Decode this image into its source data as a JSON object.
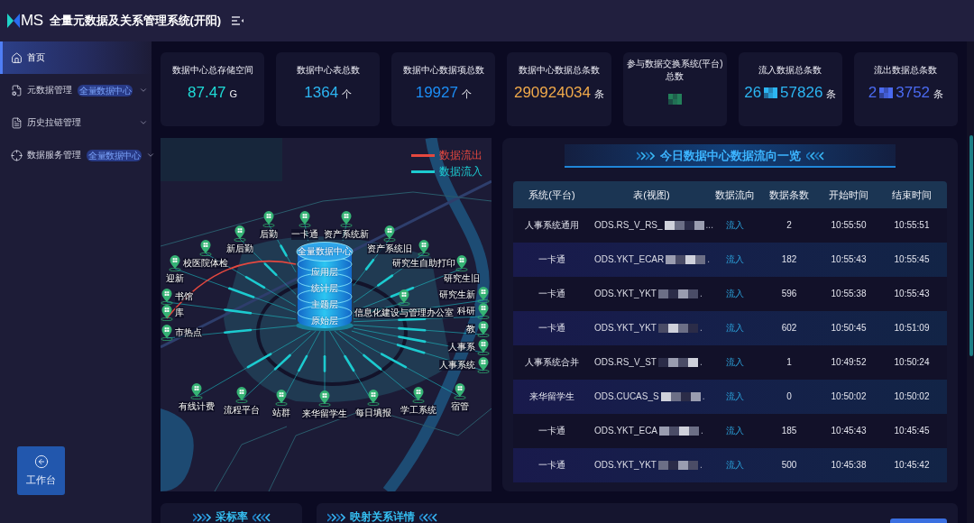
{
  "header": {
    "logo_text": "MS",
    "title": "全量元数据及关系管理系统(开阳)"
  },
  "sidebar": {
    "items": [
      {
        "label": "首页",
        "kind": "home",
        "selected": true
      },
      {
        "label": "元数据管理",
        "kind": "metadata",
        "badge": "全量数据中心",
        "expanded": false,
        "selected": false
      },
      {
        "label": "历史拉链管理",
        "kind": "history",
        "expanded": false,
        "selected": false
      },
      {
        "label": "数据服务管理",
        "kind": "service",
        "badge": "全量数据中心",
        "expanded": false,
        "selected": false
      }
    ],
    "workbench_button": "工作台"
  },
  "stats": [
    {
      "title": "数据中心总存储空间",
      "kind": "plain",
      "value": "87.47",
      "unit": "G",
      "color": "#1fdbd6"
    },
    {
      "title": "数据中心表总数",
      "kind": "plain",
      "value": "1364",
      "unit": "个",
      "color": "#2cb5f2"
    },
    {
      "title": "数据中心数据项总数",
      "kind": "plain",
      "value": "19927",
      "unit": "个",
      "color": "#1c8df5"
    },
    {
      "title": "数据中心数据总条数",
      "kind": "plain",
      "value": "290924034",
      "unit": "条",
      "color": "#f0a94a"
    },
    {
      "title": "参与数据交换系统(平台)总数",
      "kind": "masked",
      "color": "#23805a"
    },
    {
      "title": "流入数据总条数",
      "kind": "masked",
      "parts": [
        "26",
        "57826"
      ],
      "unit": "条",
      "color": "#2cb5f2"
    },
    {
      "title": "流出数据总条数",
      "kind": "masked",
      "parts": [
        "2",
        "3752"
      ],
      "unit": "条",
      "color": "#4a6af0"
    }
  ],
  "map": {
    "legend": [
      {
        "label": "数据流出",
        "kind": "out",
        "color": "#e5483f"
      },
      {
        "label": "数据流入",
        "kind": "in",
        "color": "#1ccbd0"
      }
    ],
    "center": {
      "title": "全量数据中心",
      "layers": [
        "应用层",
        "统计层",
        "主题层",
        "原始层"
      ]
    },
    "nodes": [
      {
        "label": "后勤",
        "kind": "in"
      },
      {
        "label": "一卡通",
        "kind": "in"
      },
      {
        "label": "资产系统新",
        "kind": "in"
      },
      {
        "label": "新后勤",
        "kind": "in"
      },
      {
        "label": "资产系统旧",
        "kind": "in"
      },
      {
        "label": "校医院体检",
        "kind": "in"
      },
      {
        "label": "研究生自助打印",
        "kind": "in"
      },
      {
        "label": "迎新",
        "kind": "in"
      },
      {
        "label": "研究生旧",
        "kind": "in"
      },
      {
        "label": "书馆",
        "kind": "in"
      },
      {
        "label": "研究生新",
        "kind": "in"
      },
      {
        "label": "库",
        "kind": "out"
      },
      {
        "label": "信息化建设与管理办公室",
        "kind": "in"
      },
      {
        "label": "科研",
        "kind": "in"
      },
      {
        "label": "市热点",
        "kind": "in"
      },
      {
        "label": "教",
        "kind": "in"
      },
      {
        "label": "人事系",
        "kind": "in"
      },
      {
        "label": "人事系统",
        "kind": "in"
      },
      {
        "label": "有线计费",
        "kind": "in"
      },
      {
        "label": "流程平台",
        "kind": "in"
      },
      {
        "label": "站群",
        "kind": "in"
      },
      {
        "label": "来华留学生",
        "kind": "in"
      },
      {
        "label": "每日填报",
        "kind": "in"
      },
      {
        "label": "学工系统",
        "kind": "in"
      },
      {
        "label": "宿管",
        "kind": "in"
      }
    ]
  },
  "table": {
    "title": "今日数据中心数据流向一览",
    "columns": [
      "系统(平台)",
      "表(视图)",
      "数据流向",
      "数据条数",
      "开始时间",
      "结束时间"
    ],
    "rows": [
      {
        "system": "人事系统通用",
        "table": "ODS.RS_V_RS_",
        "tail": "...",
        "direction": "流入",
        "count": "2",
        "start": "10:55:50",
        "end": "10:55:51"
      },
      {
        "system": "一卡通",
        "table": "ODS.YKT_ECAR",
        "tail": ".",
        "direction": "流入",
        "count": "182",
        "start": "10:55:43",
        "end": "10:55:45"
      },
      {
        "system": "一卡通",
        "table": "ODS.YKT_YKT",
        "tail": ".",
        "direction": "流入",
        "count": "596",
        "start": "10:55:38",
        "end": "10:55:43"
      },
      {
        "system": "一卡通",
        "table": "ODS.YKT_YKT",
        "tail": ".",
        "direction": "流入",
        "count": "602",
        "start": "10:50:45",
        "end": "10:51:09"
      },
      {
        "system": "人事系统合并",
        "table": "ODS.RS_V_ST",
        "tail": ".",
        "direction": "流入",
        "count": "1",
        "start": "10:49:52",
        "end": "10:50:24"
      },
      {
        "system": "来华留学生",
        "table": "ODS.CUCAS_S",
        "tail": ".",
        "direction": "流入",
        "count": "0",
        "start": "10:50:02",
        "end": "10:50:02"
      },
      {
        "system": "一卡通",
        "table": "ODS.YKT_ECA",
        "tail": ".",
        "direction": "流入",
        "count": "185",
        "start": "10:45:43",
        "end": "10:45:45"
      },
      {
        "system": "一卡通",
        "table": "ODS.YKT_YKT",
        "tail": ".",
        "direction": "流入",
        "count": "500",
        "start": "10:45:38",
        "end": "10:45:42"
      }
    ]
  },
  "bottom_panels": [
    {
      "title": "采标率",
      "kind": "chart"
    },
    {
      "title": "映射关系详情",
      "kind": "details"
    }
  ]
}
